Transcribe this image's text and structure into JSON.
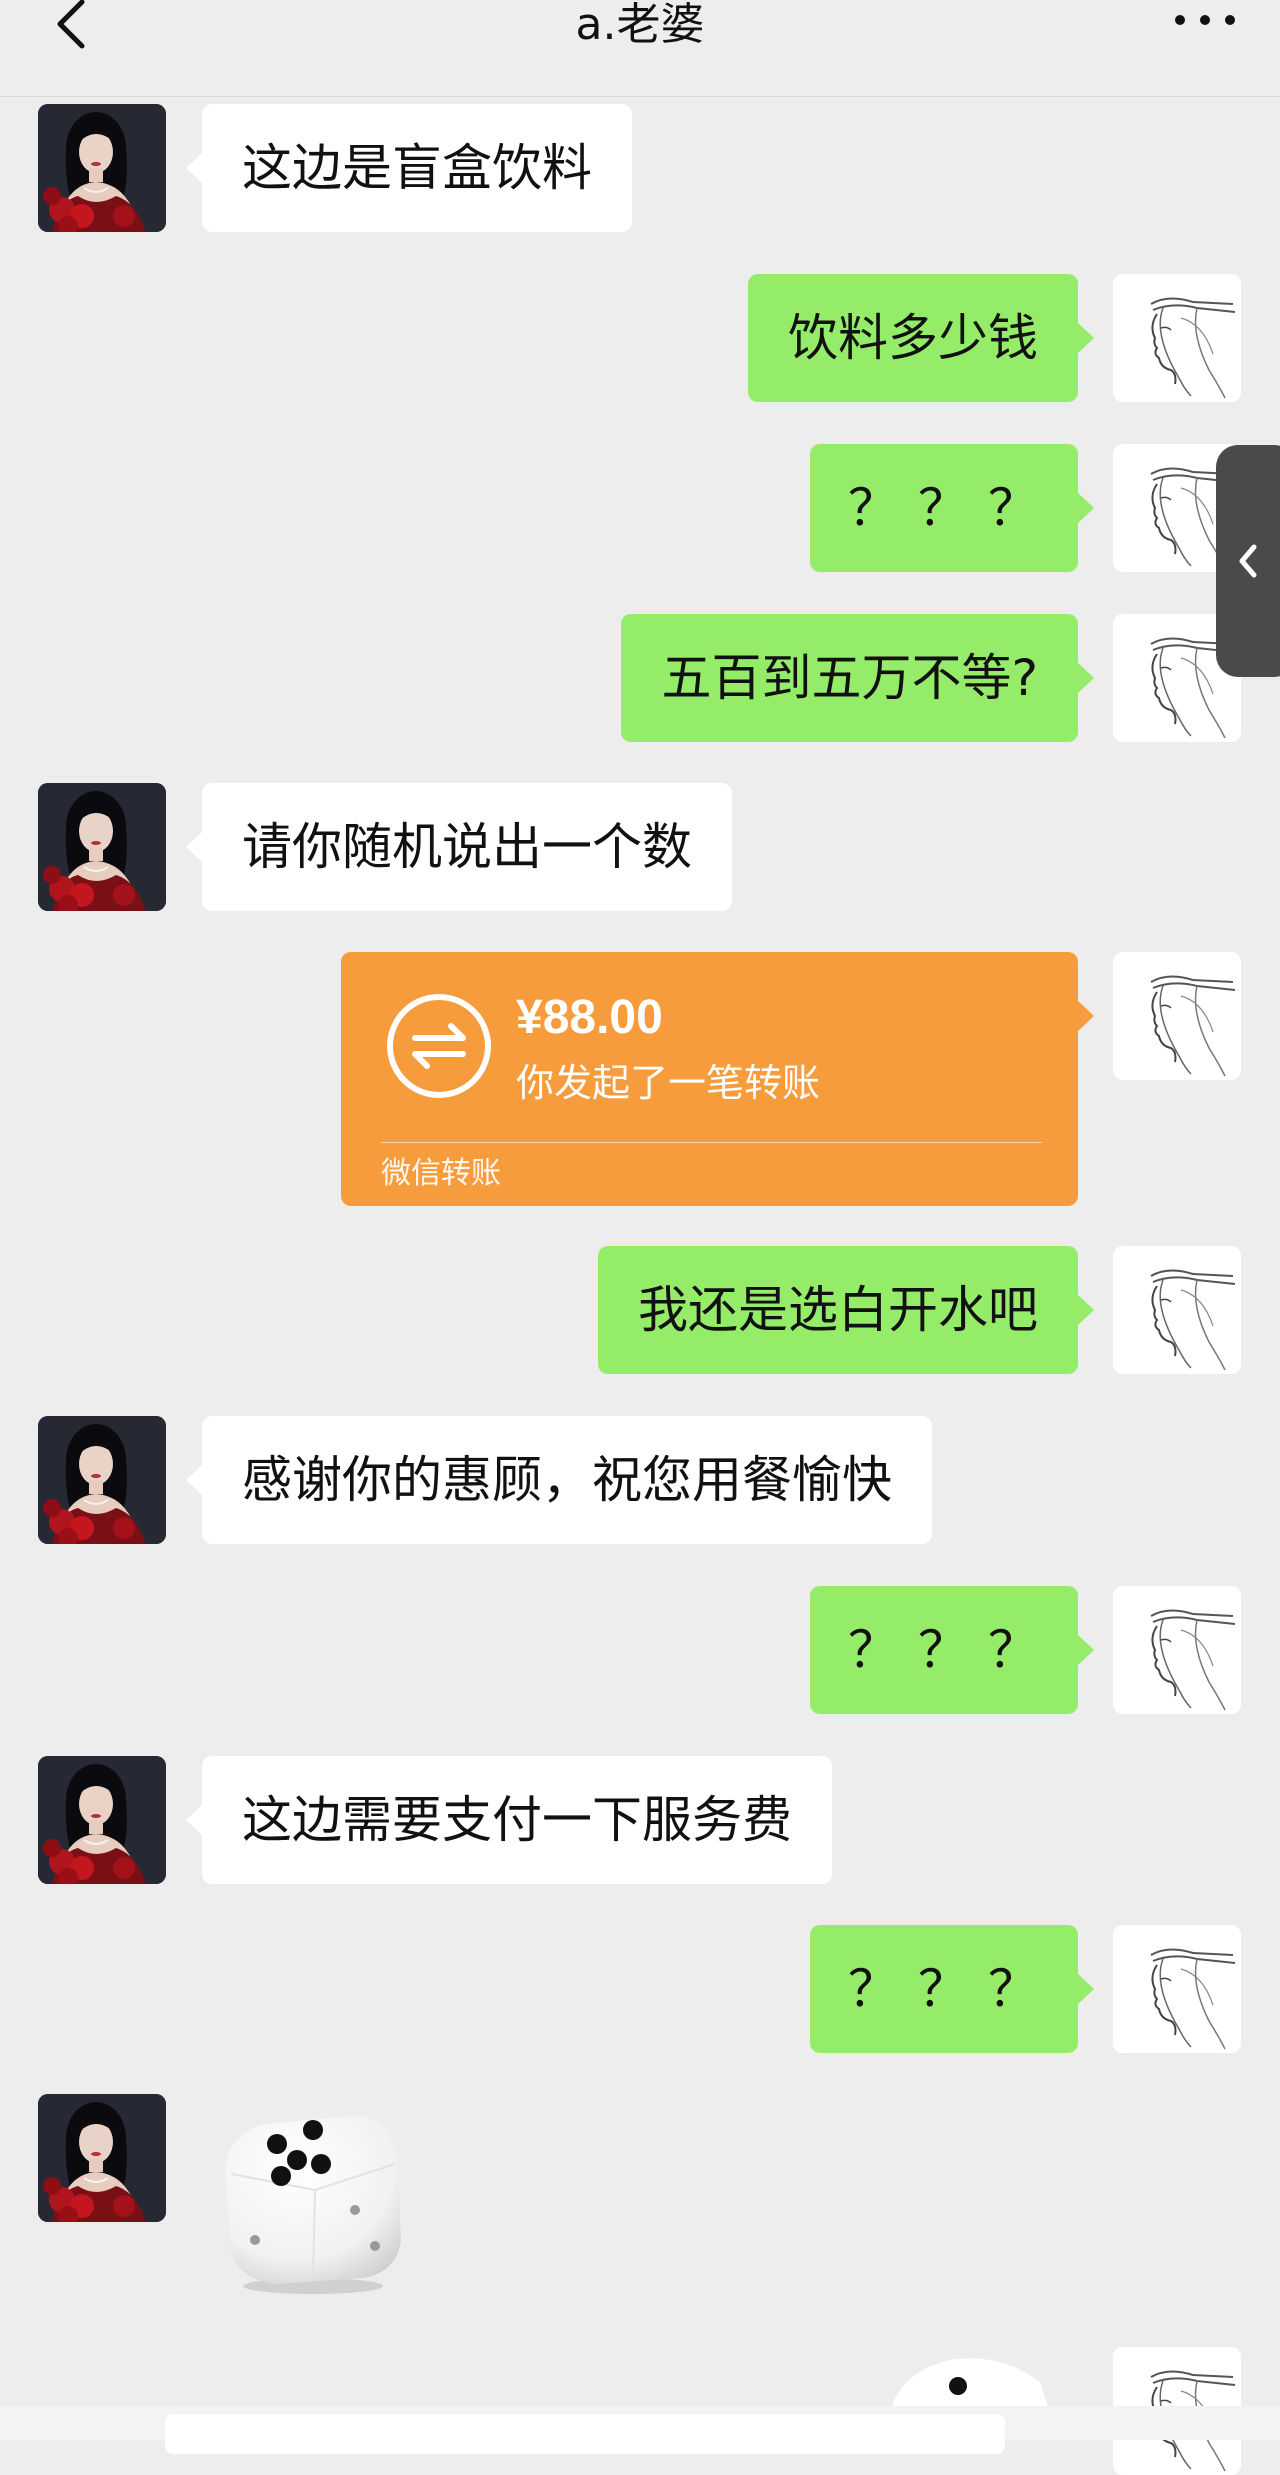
{
  "header": {
    "title": "a.老婆",
    "back_icon": "chevron-left-icon",
    "more_icon": "more-dots-icon"
  },
  "messages": [
    {
      "side": "left",
      "text": "这边是盲盒饮料"
    },
    {
      "side": "right",
      "text": "饮料多少钱"
    },
    {
      "side": "right",
      "text": "？？？"
    },
    {
      "side": "right",
      "text": "五百到五万不等?"
    },
    {
      "side": "left",
      "text": "请你随机说出一个数"
    },
    {
      "side": "right",
      "type": "transfer",
      "amount": "¥88.00",
      "desc": "你发起了一笔转账",
      "footer": "微信转账"
    },
    {
      "side": "right",
      "text": "我还是选白开水吧"
    },
    {
      "side": "left",
      "text": "感谢你的惠顾，祝您用餐愉快"
    },
    {
      "side": "right",
      "text": "？？？"
    },
    {
      "side": "left",
      "text": "这边需要支付一下服务费"
    },
    {
      "side": "right",
      "text": "？？？"
    },
    {
      "side": "left",
      "type": "dice",
      "value": 5
    },
    {
      "side": "right",
      "type": "dice"
    }
  ],
  "side_tab": {
    "icon": "chevron-left-icon"
  },
  "colors": {
    "background": "#ededed",
    "bubble_self": "#95ec69",
    "bubble_other": "#ffffff",
    "transfer": "#f79c3c",
    "side_tab": "#4a4a4a"
  }
}
